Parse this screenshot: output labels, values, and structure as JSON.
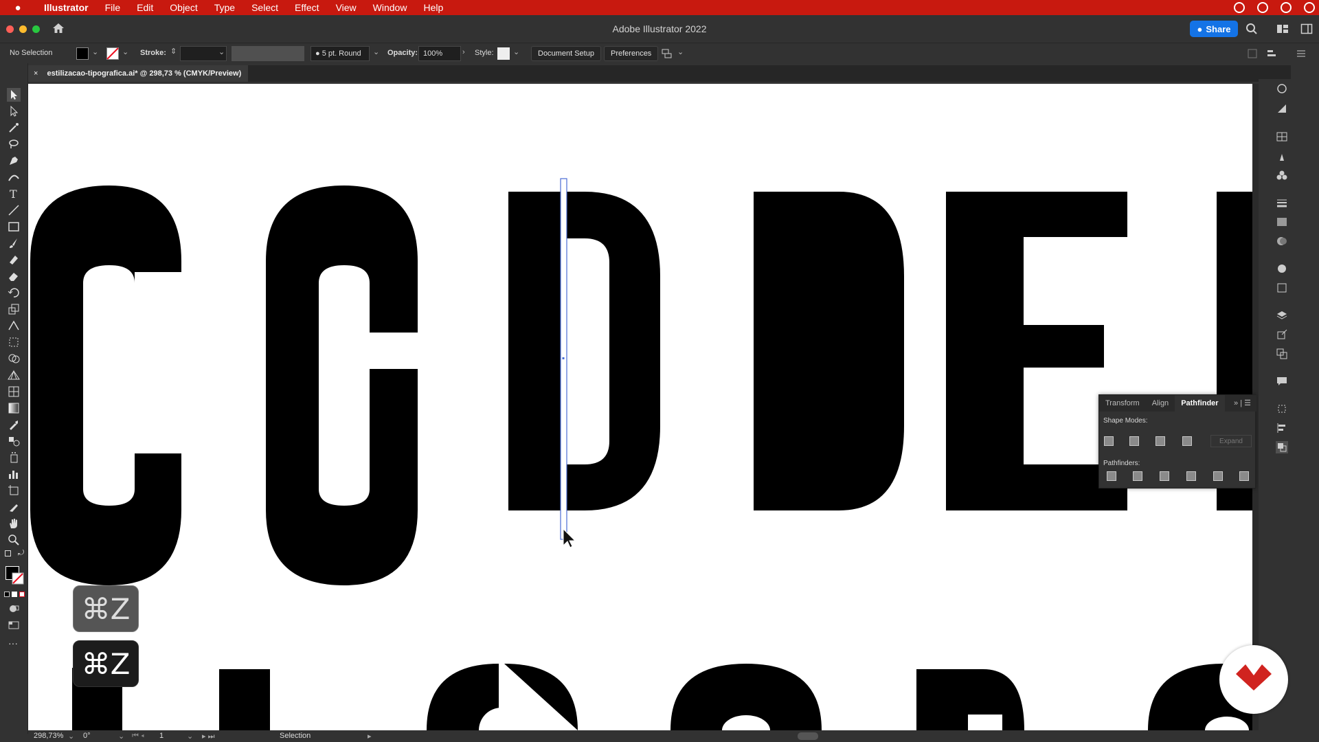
{
  "menubar": {
    "app": "Illustrator",
    "items": [
      "File",
      "Edit",
      "Object",
      "Type",
      "Select",
      "Effect",
      "View",
      "Window",
      "Help"
    ]
  },
  "window": {
    "title": "Adobe Illustrator 2022",
    "share_label": "Share"
  },
  "control": {
    "selection": "No Selection",
    "stroke_label": "Stroke:",
    "brush": "5 pt. Round",
    "opacity_label": "Opacity:",
    "opacity_value": "100%",
    "style_label": "Style:",
    "document_setup": "Document Setup",
    "preferences": "Preferences"
  },
  "document": {
    "tab_title": "estilizacao-tipografica.ai* @ 298,73 % (CMYK/Preview)"
  },
  "pathfinder_panel": {
    "tabs": [
      "Transform",
      "Align",
      "Pathfinder"
    ],
    "shape_modes_label": "Shape Modes:",
    "expand_label": "Expand",
    "pathfinders_label": "Pathfinders:"
  },
  "overlay": {
    "shortcut_1": "⌘Z",
    "shortcut_2": "⌘Z"
  },
  "status": {
    "zoom": "298,73%",
    "rotation": "0°",
    "artboard": "1",
    "tool": "Selection"
  },
  "colors": {
    "menubar": "#c8190f",
    "accent": "#1473e6",
    "selection": "#4a6cd4",
    "brand_logo": "#d0231f"
  }
}
